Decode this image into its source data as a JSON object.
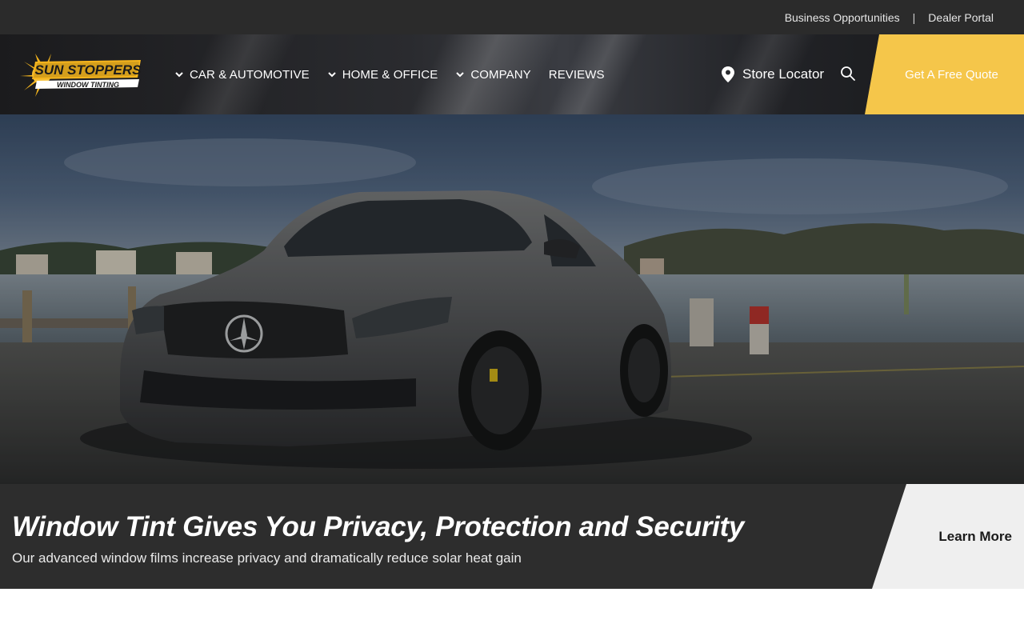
{
  "topbar": {
    "business_link": "Business Opportunities",
    "separator": "|",
    "dealer_link": "Dealer Portal"
  },
  "logo": {
    "line1": "SUN STOPPERS",
    "line2": "WINDOW TINTING"
  },
  "nav": {
    "items": [
      {
        "label": "CAR & AUTOMOTIVE",
        "icon": "chevron-down-icon"
      },
      {
        "label": "HOME & OFFICE",
        "icon": "chevron-down-icon"
      },
      {
        "label": "COMPANY",
        "icon": "chevron-down-icon"
      },
      {
        "label": "REVIEWS"
      }
    ],
    "store_locator": "Store Locator",
    "quote_button": "Get A Free Quote"
  },
  "hero": {
    "headline": "Window Tint Gives You Privacy, Protection and Security",
    "subtext": "Our advanced window films increase privacy and dramatically reduce solar heat gain",
    "cta": "Learn More"
  },
  "colors": {
    "accent": "#f5c64a",
    "dark": "#2b2b2b",
    "caption_bg": "#2d2d2d",
    "cta_bg": "#efefef"
  }
}
